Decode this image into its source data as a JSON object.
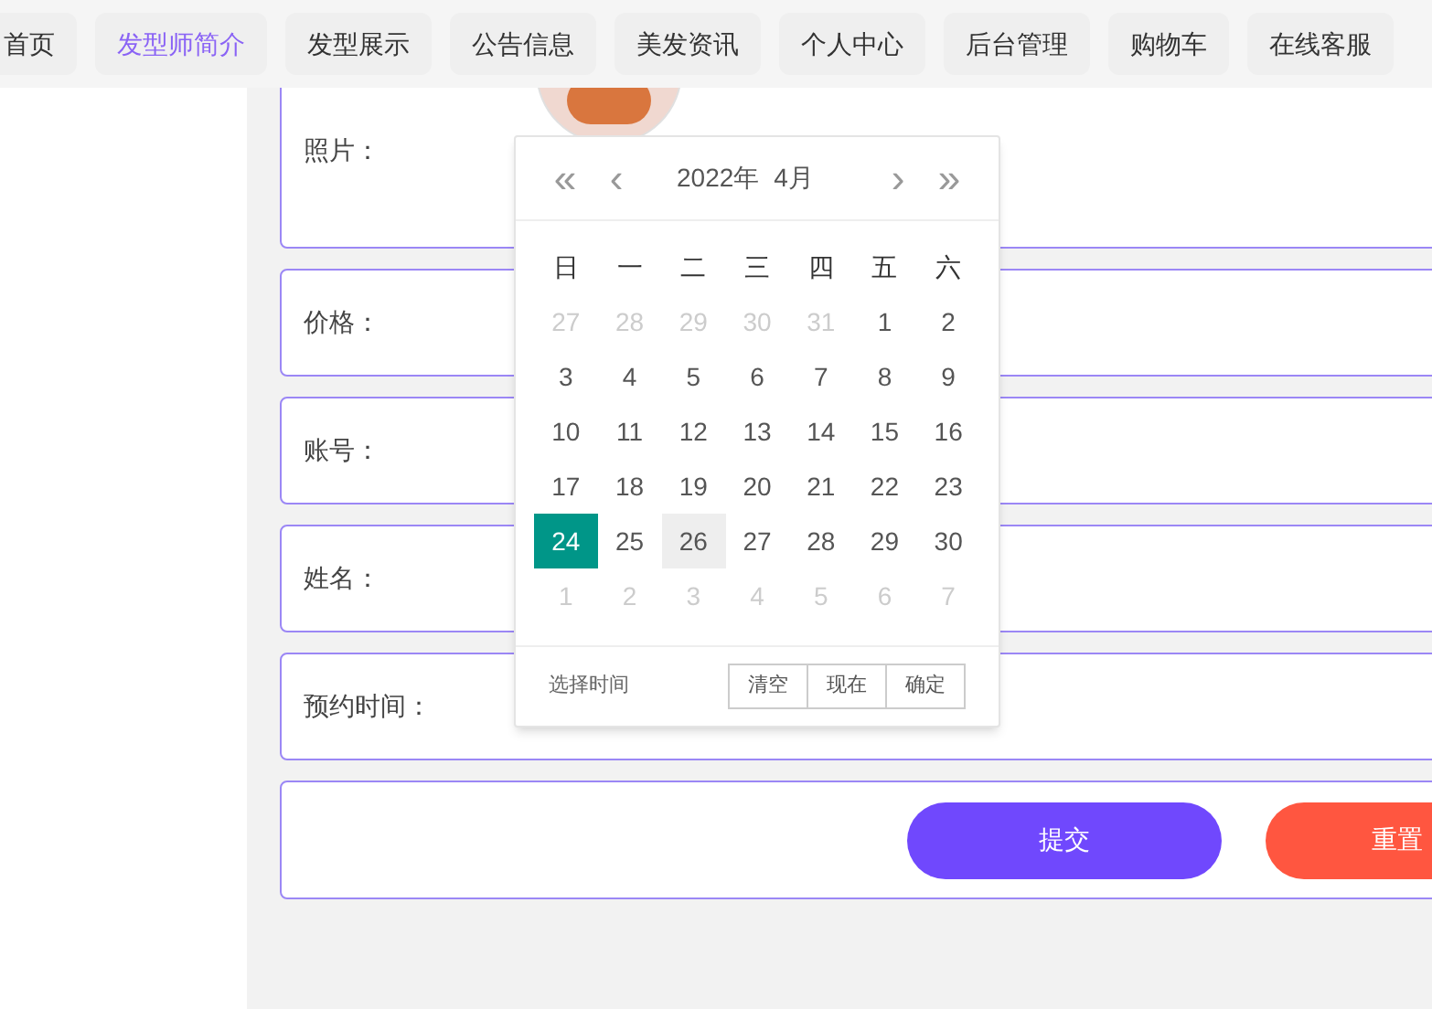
{
  "nav": [
    {
      "label": "首页",
      "selected": false
    },
    {
      "label": "发型师简介",
      "selected": true
    },
    {
      "label": "发型展示",
      "selected": false
    },
    {
      "label": "公告信息",
      "selected": false
    },
    {
      "label": "美发资讯",
      "selected": false
    },
    {
      "label": "个人中心",
      "selected": false
    },
    {
      "label": "后台管理",
      "selected": false
    },
    {
      "label": "购物车",
      "selected": false
    },
    {
      "label": "在线客服",
      "selected": false
    }
  ],
  "form": {
    "fields": [
      {
        "label": "照片：",
        "kind": "photo"
      },
      {
        "label": "价格：",
        "kind": "text"
      },
      {
        "label": "账号：",
        "kind": "text"
      },
      {
        "label": "姓名：",
        "kind": "text"
      },
      {
        "label": "预约时间：",
        "kind": "date",
        "focused": true
      }
    ],
    "buttons": [
      {
        "label": "提交",
        "kind": "submit"
      },
      {
        "label": "重置",
        "kind": "reset"
      }
    ]
  },
  "date_picker": {
    "year": "2022年",
    "month": "4月",
    "prev_year": "«",
    "prev_month": "‹",
    "next_month": "›",
    "next_year": "»",
    "weekdays": [
      "日",
      "一",
      "二",
      "三",
      "四",
      "五",
      "六"
    ],
    "days": [
      {
        "label": "27",
        "muted": true,
        "selected": false,
        "hovered": false
      },
      {
        "label": "28",
        "muted": true,
        "selected": false,
        "hovered": false
      },
      {
        "label": "29",
        "muted": true,
        "selected": false,
        "hovered": false
      },
      {
        "label": "30",
        "muted": true,
        "selected": false,
        "hovered": false
      },
      {
        "label": "31",
        "muted": true,
        "selected": false,
        "hovered": false
      },
      {
        "label": "1",
        "muted": false,
        "selected": false,
        "hovered": false
      },
      {
        "label": "2",
        "muted": false,
        "selected": false,
        "hovered": false
      },
      {
        "label": "3",
        "muted": false,
        "selected": false,
        "hovered": false
      },
      {
        "label": "4",
        "muted": false,
        "selected": false,
        "hovered": false
      },
      {
        "label": "5",
        "muted": false,
        "selected": false,
        "hovered": false
      },
      {
        "label": "6",
        "muted": false,
        "selected": false,
        "hovered": false
      },
      {
        "label": "7",
        "muted": false,
        "selected": false,
        "hovered": false
      },
      {
        "label": "8",
        "muted": false,
        "selected": false,
        "hovered": false
      },
      {
        "label": "9",
        "muted": false,
        "selected": false,
        "hovered": false
      },
      {
        "label": "10",
        "muted": false,
        "selected": false,
        "hovered": false
      },
      {
        "label": "11",
        "muted": false,
        "selected": false,
        "hovered": false
      },
      {
        "label": "12",
        "muted": false,
        "selected": false,
        "hovered": false
      },
      {
        "label": "13",
        "muted": false,
        "selected": false,
        "hovered": false
      },
      {
        "label": "14",
        "muted": false,
        "selected": false,
        "hovered": false
      },
      {
        "label": "15",
        "muted": false,
        "selected": false,
        "hovered": false
      },
      {
        "label": "16",
        "muted": false,
        "selected": false,
        "hovered": false
      },
      {
        "label": "17",
        "muted": false,
        "selected": false,
        "hovered": false
      },
      {
        "label": "18",
        "muted": false,
        "selected": false,
        "hovered": false
      },
      {
        "label": "19",
        "muted": false,
        "selected": false,
        "hovered": false
      },
      {
        "label": "20",
        "muted": false,
        "selected": false,
        "hovered": false
      },
      {
        "label": "21",
        "muted": false,
        "selected": false,
        "hovered": false
      },
      {
        "label": "22",
        "muted": false,
        "selected": false,
        "hovered": false
      },
      {
        "label": "23",
        "muted": false,
        "selected": false,
        "hovered": false
      },
      {
        "label": "24",
        "muted": false,
        "selected": true,
        "hovered": false
      },
      {
        "label": "25",
        "muted": false,
        "selected": false,
        "hovered": false
      },
      {
        "label": "26",
        "muted": false,
        "selected": false,
        "hovered": true
      },
      {
        "label": "27",
        "muted": false,
        "selected": false,
        "hovered": false
      },
      {
        "label": "28",
        "muted": false,
        "selected": false,
        "hovered": false
      },
      {
        "label": "29",
        "muted": false,
        "selected": false,
        "hovered": false
      },
      {
        "label": "30",
        "muted": false,
        "selected": false,
        "hovered": false
      },
      {
        "label": "1",
        "muted": true,
        "selected": false,
        "hovered": false
      },
      {
        "label": "2",
        "muted": true,
        "selected": false,
        "hovered": false
      },
      {
        "label": "3",
        "muted": true,
        "selected": false,
        "hovered": false
      },
      {
        "label": "4",
        "muted": true,
        "selected": false,
        "hovered": false
      },
      {
        "label": "5",
        "muted": true,
        "selected": false,
        "hovered": false
      },
      {
        "label": "6",
        "muted": true,
        "selected": false,
        "hovered": false
      },
      {
        "label": "7",
        "muted": true,
        "selected": false,
        "hovered": false
      }
    ],
    "footer_label": "选择时间",
    "buttons": [
      "清空",
      "现在",
      "确定"
    ]
  }
}
